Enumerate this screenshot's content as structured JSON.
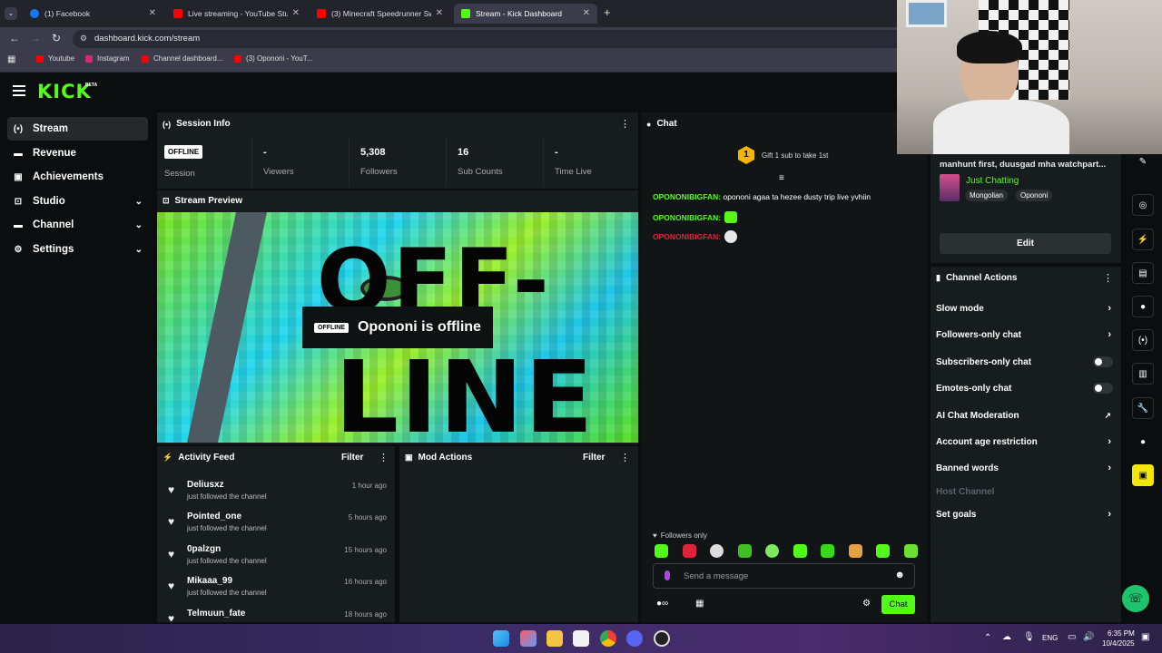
{
  "browser": {
    "tabs": [
      {
        "label": "(1) Facebook",
        "color": "#1877f2"
      },
      {
        "label": "Live streaming - YouTube Studio",
        "color": "#ff0000"
      },
      {
        "label": "(3) Minecraft Speedrunner Swa",
        "color": "#ff0000"
      },
      {
        "label": "Stream - Kick Dashboard",
        "color": "#53fc18"
      }
    ],
    "new_tab": "+",
    "url": "dashboard.kick.com/stream",
    "bookmarks": [
      "Youtube",
      "Instagram",
      "Channel dashboard...",
      "(3) Opononi - YouT..."
    ]
  },
  "app": {
    "logo": "KICK",
    "logo_badge": "BETA",
    "accent": "#53fc18"
  },
  "sidebar": {
    "items": [
      {
        "label": "Stream",
        "icon": "broadcast-icon"
      },
      {
        "label": "Revenue",
        "icon": "revenue-icon"
      },
      {
        "label": "Achievements",
        "icon": "achievements-icon"
      },
      {
        "label": "Studio",
        "icon": "studio-icon"
      },
      {
        "label": "Channel",
        "icon": "channel-icon"
      },
      {
        "label": "Settings",
        "icon": "gear-icon"
      }
    ]
  },
  "session": {
    "title": "Session Info",
    "status_badge": "OFFLINE",
    "status_label": "Session",
    "stats": [
      {
        "value": "-",
        "label": "Viewers"
      },
      {
        "value": "5,308",
        "label": "Followers"
      },
      {
        "value": "16",
        "label": "Sub Counts"
      },
      {
        "value": "-",
        "label": "Time Live"
      }
    ]
  },
  "preview": {
    "title": "Stream Preview",
    "badge": "OFFLINE",
    "message": "Opononi is offline",
    "big_text_1": "OFF-",
    "big_text_2": "LINE"
  },
  "activity": {
    "title": "Activity Feed",
    "filter": "Filter",
    "items": [
      {
        "name": "Deliusxz",
        "action": "just followed the channel",
        "time": "1 hour ago"
      },
      {
        "name": "Pointed_one",
        "action": "just followed the channel",
        "time": "5 hours ago"
      },
      {
        "name": "0palzgn",
        "action": "just followed the channel",
        "time": "15 hours ago"
      },
      {
        "name": "Mikaaa_99",
        "action": "just followed the channel",
        "time": "16 hours ago"
      },
      {
        "name": "Telmuun_fate",
        "action": "",
        "time": "18 hours ago"
      }
    ]
  },
  "mod": {
    "title": "Mod Actions",
    "filter": "Filter"
  },
  "chat": {
    "title": "Chat",
    "gift_rank": "1",
    "gift_text": "Gift 1 sub to take 1st",
    "messages": [
      {
        "user": "OPONONIBIGFAN:",
        "text": "opononi agaa ta hezee dusty trip live yvhiin",
        "color": "#53fc18"
      },
      {
        "user": "OPONONIBIGFAN:",
        "text": "",
        "color": "#53fc18"
      },
      {
        "user": "OPONONIBIGFAN:",
        "text": "",
        "color": "#e0233b"
      }
    ],
    "followers_only": "Followers only",
    "input_placeholder": "Send a message",
    "send_label": "Chat"
  },
  "stream_info": {
    "title_text": "manhunt first, duusgad mha watchpart...",
    "category": "Just Chatting",
    "tags": [
      "Mongolian",
      "Opononi"
    ],
    "edit_label": "Edit"
  },
  "channel_actions": {
    "title": "Channel Actions",
    "items": [
      {
        "label": "Slow mode",
        "control": "chevron"
      },
      {
        "label": "Followers-only chat",
        "control": "chevron"
      },
      {
        "label": "Subscribers-only chat",
        "control": "toggle"
      },
      {
        "label": "Emotes-only chat",
        "control": "toggle"
      },
      {
        "label": "AI Chat Moderation",
        "control": "external"
      },
      {
        "label": "Account age restriction",
        "control": "chevron"
      },
      {
        "label": "Banned words",
        "control": "chevron"
      },
      {
        "label": "Host Channel",
        "control": "none"
      },
      {
        "label": "Set goals",
        "control": "chevron"
      }
    ]
  },
  "taskbar": {
    "lang": "ENG",
    "time": "6:35 PM",
    "date": "10/4/2025"
  }
}
